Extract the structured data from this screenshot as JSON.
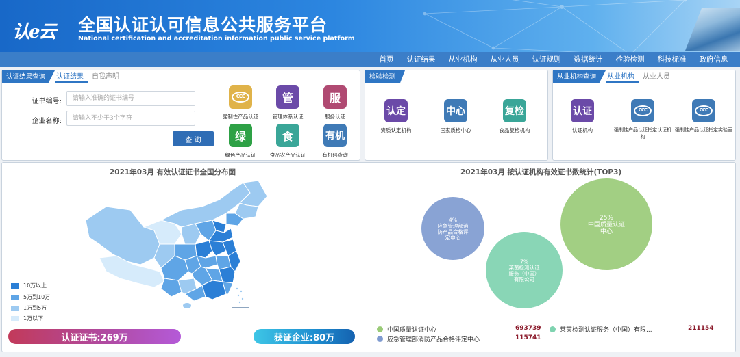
{
  "header": {
    "logo_text": "认e云",
    "title": "全国认证认可信息公共服务平台",
    "subtitle": "National certification and accreditation information public service platform"
  },
  "nav": [
    "首页",
    "认证结果",
    "从业机构",
    "从业人员",
    "认证规则",
    "数据统计",
    "检验检测",
    "科技标准",
    "政府信息"
  ],
  "panel1": {
    "head": "认证结果查询",
    "tabs": [
      "认证结果",
      "自我声明"
    ],
    "cert_label": "证书编号:",
    "cert_placeholder": "请输入准确的证书编号",
    "company_label": "企业名称:",
    "company_placeholder": "请输入不少于3个字符",
    "query_button": "查 询",
    "tiles": [
      {
        "icon": "ccc-icon",
        "glyph": "",
        "label": "强制性产品认证",
        "color": "#e0b34a"
      },
      {
        "icon": "guan-icon",
        "glyph": "管",
        "label": "管理体系认证",
        "color": "#6b4aa8"
      },
      {
        "icon": "fu-icon",
        "glyph": "服",
        "label": "服务认证",
        "color": "#b04a72"
      },
      {
        "icon": "lv-icon",
        "glyph": "绿",
        "label": "绿色产品认证",
        "color": "#2ea146"
      },
      {
        "icon": "shi-icon",
        "glyph": "食",
        "label": "食品农产品认证",
        "color": "#3aa698"
      },
      {
        "icon": "youji-icon",
        "glyph": "有机",
        "label": "有机码查询",
        "color": "#3f7ab6"
      }
    ]
  },
  "panel2": {
    "head": "检验检测",
    "tiles": [
      {
        "icon": "rending-icon",
        "glyph": "认定",
        "label": "资质认定机构",
        "color": "#6b4aa8"
      },
      {
        "icon": "zhongxin-icon",
        "glyph": "中心",
        "label": "国家质检中心",
        "color": "#3f7ab6"
      },
      {
        "icon": "fujian-icon",
        "glyph": "复检",
        "label": "食品复检机构",
        "color": "#3aa698"
      }
    ]
  },
  "panel3": {
    "head": "从业机构查询",
    "tabs": [
      "从业机构",
      "从业人员"
    ],
    "tiles": [
      {
        "icon": "renzheng-icon",
        "glyph": "认证",
        "label": "认证机构",
        "color": "#6b4aa8"
      },
      {
        "icon": "ccc-icon",
        "glyph": "",
        "label": "强制性产品认证指定认证机构",
        "color": "#3f7ab6"
      },
      {
        "icon": "ccc-icon",
        "glyph": "",
        "label": "强制性产品认证指定实验室",
        "color": "#3f7ab6"
      }
    ]
  },
  "map": {
    "title": "2021年03月  有效认证证书全国分布图",
    "legend": [
      {
        "label": "10万以上",
        "color": "#2b7fd6"
      },
      {
        "label": "5万到10万",
        "color": "#5fa5e6"
      },
      {
        "label": "1万到5万",
        "color": "#9dcaf1"
      },
      {
        "label": "1万以下",
        "color": "#d6ebfb"
      }
    ],
    "stat_certs": "认证证书:269万",
    "stat_companies": "获证企业:80万"
  },
  "chart_data": {
    "type": "bubble",
    "title": "2021年03月   按认证机构有效证书数统计(TOP3)",
    "series": [
      {
        "name": "中国质量认证中心",
        "value": 693739,
        "percent": "25%",
        "color": "#9acb78"
      },
      {
        "name": "应急管理部消防产品合格评定中心",
        "value": 115741,
        "percent": "4%",
        "color": "#7f9bd0"
      },
      {
        "name": "莱茵检测认证服务（中国）有限公司",
        "value": 211154,
        "percent": "7%",
        "color": "#7fd3b0"
      }
    ],
    "bubble_labels": [
      "25%\n中国质量认证\n中心",
      "4%\n应急管理部消\n防产品合格评\n定中心",
      "7%\n莱茵检测认证\n服务（中国）\n有限公司"
    ],
    "legend_names": [
      "中国质量认证中心",
      "应急管理部消防产品合格评定中心",
      "莱茵检测认证服务（中国）有限..."
    ],
    "legend_values": [
      "693739",
      "115741",
      "211154"
    ]
  }
}
